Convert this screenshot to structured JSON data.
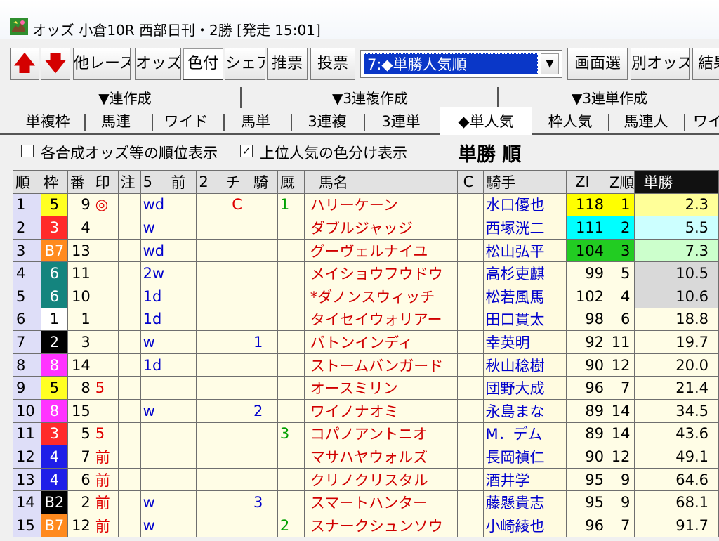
{
  "window": {
    "title": "オッズ 小倉10R 西部日刊・2勝  [発走 15:01]"
  },
  "toolbar": {
    "up_label": "🡅",
    "down_label": "🡇",
    "buttons": [
      "他レース",
      "オッズ",
      "色付",
      "シェア",
      "推票",
      "投票"
    ],
    "select_value": "7:◆単勝人気順",
    "right_buttons": [
      "画面選",
      "別オッズ",
      "結果"
    ]
  },
  "tab_groups": [
    "▼連作成",
    "▼3連複作成",
    "▼3連単作成"
  ],
  "tabs": [
    "単複枠",
    "馬連",
    "ワイド",
    "馬単",
    "3連複",
    "3連単",
    "◆単人気",
    "枠人気",
    "馬連人",
    "ワイ"
  ],
  "options": {
    "opt1_label": "各合成オッズ等の順位表示",
    "opt1_checked": "",
    "opt2_label": "上位人気の色分け表示",
    "opt2_checked": "✓",
    "heading": "単勝 順"
  },
  "columns": [
    "順",
    "枠",
    "番",
    "印",
    "注",
    "5",
    "前",
    "2",
    "チ",
    "騎",
    "厩",
    "馬名",
    "C",
    "騎手",
    "ZI",
    "Z順",
    "単勝"
  ],
  "rows": [
    {
      "rank": "1",
      "waku": "5",
      "uma": "9",
      "mark": "◎",
      "note": "",
      "c5": "wd",
      "pre": "",
      "c2": "",
      "chi": "C",
      "ki": "",
      "kyu": "1",
      "horse": "ハリーケーン",
      "c": "",
      "jockey": "水口優也",
      "zi": "118",
      "zr": "1",
      "odds": "2.3"
    },
    {
      "rank": "2",
      "waku": "3",
      "uma": "4",
      "mark": "",
      "note": "",
      "c5": "w",
      "pre": "",
      "c2": "",
      "chi": "",
      "ki": "",
      "kyu": "",
      "horse": "ダブルジャッジ",
      "c": "",
      "jockey": "西塚洸二",
      "zi": "111",
      "zr": "2",
      "odds": "5.5"
    },
    {
      "rank": "3",
      "waku": "B7",
      "uma": "13",
      "mark": "",
      "note": "",
      "c5": "wd",
      "pre": "",
      "c2": "",
      "chi": "",
      "ki": "",
      "kyu": "",
      "horse": "グーヴェルナイユ",
      "c": "",
      "jockey": "松山弘平",
      "zi": "104",
      "zr": "3",
      "odds": "7.3"
    },
    {
      "rank": "4",
      "waku": "6",
      "uma": "11",
      "mark": "",
      "note": "",
      "c5": "2w",
      "pre": "",
      "c2": "",
      "chi": "",
      "ki": "",
      "kyu": "",
      "horse": "メイショウフウドウ",
      "c": "",
      "jockey": "高杉吏麒",
      "zi": "99",
      "zr": "5",
      "odds": "10.5"
    },
    {
      "rank": "5",
      "waku": "6",
      "uma": "10",
      "mark": "",
      "note": "",
      "c5": "1d",
      "pre": "",
      "c2": "",
      "chi": "",
      "ki": "",
      "kyu": "",
      "horse": "*ダノンスウィッチ",
      "c": "",
      "jockey": "松若風馬",
      "zi": "102",
      "zr": "4",
      "odds": "10.6"
    },
    {
      "rank": "6",
      "waku": "1",
      "uma": "1",
      "mark": "",
      "note": "",
      "c5": "1d",
      "pre": "",
      "c2": "",
      "chi": "",
      "ki": "",
      "kyu": "",
      "horse": "タイセイウォリアー",
      "c": "",
      "jockey": "田口貫太",
      "zi": "98",
      "zr": "6",
      "odds": "18.8"
    },
    {
      "rank": "7",
      "waku": "2",
      "uma": "3",
      "mark": "",
      "note": "",
      "c5": "w",
      "pre": "",
      "c2": "",
      "chi": "",
      "ki": "1",
      "kyu": "",
      "horse": "バトンインディ",
      "c": "",
      "jockey": "幸英明",
      "zi": "92",
      "zr": "11",
      "odds": "19.7"
    },
    {
      "rank": "8",
      "waku": "8",
      "uma": "14",
      "mark": "",
      "note": "",
      "c5": "1d",
      "pre": "",
      "c2": "",
      "chi": "",
      "ki": "",
      "kyu": "",
      "horse": "ストームバンガード",
      "c": "",
      "jockey": "秋山稔樹",
      "zi": "90",
      "zr": "12",
      "odds": "20.0"
    },
    {
      "rank": "9",
      "waku": "5",
      "uma": "8",
      "mark": "5",
      "note": "",
      "c5": "",
      "pre": "",
      "c2": "",
      "chi": "",
      "ki": "",
      "kyu": "",
      "horse": "オースミリン",
      "c": "",
      "jockey": "団野大成",
      "zi": "96",
      "zr": "7",
      "odds": "21.4"
    },
    {
      "rank": "10",
      "waku": "8",
      "uma": "15",
      "mark": "",
      "note": "",
      "c5": "w",
      "pre": "",
      "c2": "",
      "chi": "",
      "ki": "2",
      "kyu": "",
      "horse": "ワイノナオミ",
      "c": "",
      "jockey": "永島まな",
      "zi": "89",
      "zr": "14",
      "odds": "34.5"
    },
    {
      "rank": "11",
      "waku": "3",
      "uma": "5",
      "mark": "5",
      "note": "",
      "c5": "",
      "pre": "",
      "c2": "",
      "chi": "",
      "ki": "",
      "kyu": "3",
      "horse": "コパノアントニオ",
      "c": "",
      "jockey": "M．デム",
      "zi": "89",
      "zr": "14",
      "odds": "43.6"
    },
    {
      "rank": "12",
      "waku": "4",
      "uma": "7",
      "mark": "前",
      "note": "",
      "c5": "",
      "pre": "",
      "c2": "",
      "chi": "",
      "ki": "",
      "kyu": "",
      "horse": "マサハヤウォルズ",
      "c": "",
      "jockey": "長岡禎仁",
      "zi": "90",
      "zr": "12",
      "odds": "49.1"
    },
    {
      "rank": "13",
      "waku": "4",
      "uma": "6",
      "mark": "前",
      "note": "",
      "c5": "",
      "pre": "",
      "c2": "",
      "chi": "",
      "ki": "",
      "kyu": "",
      "horse": "クリノクリスタル",
      "c": "",
      "jockey": "酒井学",
      "zi": "95",
      "zr": "9",
      "odds": "64.6"
    },
    {
      "rank": "14",
      "waku": "B2",
      "uma": "2",
      "mark": "前",
      "note": "",
      "c5": "w",
      "pre": "",
      "c2": "",
      "chi": "",
      "ki": "3",
      "kyu": "",
      "horse": "スマートハンター",
      "c": "",
      "jockey": "藤懸貴志",
      "zi": "95",
      "zr": "9",
      "odds": "68.1"
    },
    {
      "rank": "15",
      "waku": "B7",
      "uma": "12",
      "mark": "前",
      "note": "",
      "c5": "w",
      "pre": "",
      "c2": "",
      "chi": "",
      "ki": "",
      "kyu": "2",
      "horse": "スナークシュンソウ",
      "c": "",
      "jockey": "小崎綾也",
      "zi": "96",
      "zr": "7",
      "odds": "91.7"
    }
  ],
  "colors": {
    "waku": {
      "1": "#ffffff",
      "2": "#000000",
      "3": "#ff2a2a",
      "4": "#1e1ee8",
      "5": "#ffff22",
      "6": "#14847e",
      "7": "#ff8a1e",
      "8": "#ff33ff"
    },
    "rank_highlight": [
      "#ffff00",
      "#00ffff",
      "#22cc22"
    ],
    "odds_highlight": [
      "#ffff99",
      "#ccffff",
      "#ccffcc",
      "#d9d9d9",
      "#d9d9d9"
    ]
  }
}
